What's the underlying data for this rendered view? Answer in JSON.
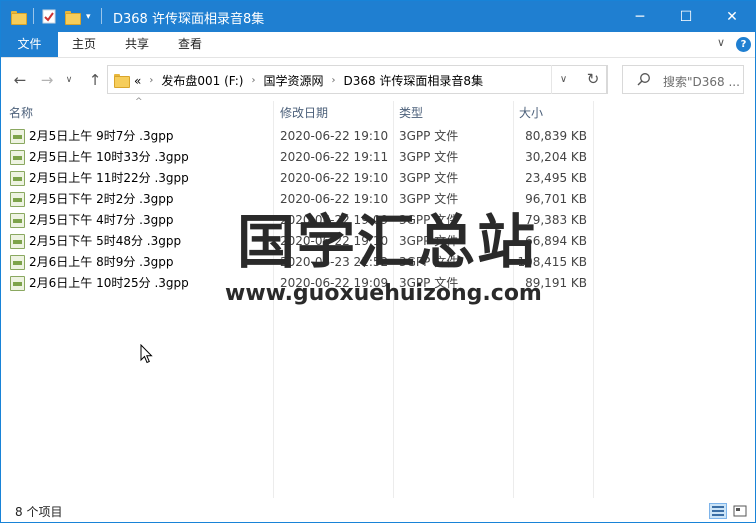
{
  "window": {
    "title": "D368 许传琛面相录音8集",
    "controls": {
      "minimize": "─",
      "maximize": "☐",
      "close": "✕"
    }
  },
  "ribbon": {
    "tabs": [
      "文件",
      "主页",
      "共享",
      "查看"
    ],
    "expand_glyph": "∨",
    "help_glyph": "?"
  },
  "nav": {
    "back": "←",
    "forward": "→",
    "recent": "∨",
    "up": "↑"
  },
  "address": {
    "overflow": "«",
    "crumbs": [
      "发布盘001 (F:)",
      "国学资源网",
      "D368 许传琛面相录音8集"
    ],
    "separator": "›",
    "dropdown": "∨",
    "refresh": "↻"
  },
  "search": {
    "placeholder": "搜索\"D368 ..."
  },
  "columns": {
    "name": "名称",
    "date": "修改日期",
    "type": "类型",
    "size": "大小"
  },
  "files": [
    {
      "name": "2月5日上午 9时7分 .3gpp",
      "date": "2020-06-22 19:10",
      "type": "3GPP 文件",
      "size": "80,839 KB"
    },
    {
      "name": "2月5日上午 10时33分 .3gpp",
      "date": "2020-06-22 19:11",
      "type": "3GPP 文件",
      "size": "30,204 KB"
    },
    {
      "name": "2月5日上午 11时22分 .3gpp",
      "date": "2020-06-22 19:10",
      "type": "3GPP 文件",
      "size": "23,495 KB"
    },
    {
      "name": "2月5日下午 2时2分 .3gpp",
      "date": "2020-06-22 19:10",
      "type": "3GPP 文件",
      "size": "96,701 KB"
    },
    {
      "name": "2月5日下午 4时7分 .3gpp",
      "date": "2020-06-22 19:09",
      "type": "3GPP 文件",
      "size": "79,383 KB"
    },
    {
      "name": "2月5日下午 5时48分 .3gpp",
      "date": "2020-06-22 19:10",
      "type": "3GPP 文件",
      "size": "66,894 KB"
    },
    {
      "name": "2月6日上午 8时9分 .3gpp",
      "date": "2020-06-23 21:52",
      "type": "3GPP 文件",
      "size": "108,415 KB"
    },
    {
      "name": "2月6日上午 10时25分 .3gpp",
      "date": "2020-06-22 19:09",
      "type": "3GPP 文件",
      "size": "89,191 KB"
    }
  ],
  "watermark": {
    "title": "国学汇总站",
    "url": "www.guoxuehuizong.com"
  },
  "status": {
    "item_count": "8 个项目"
  },
  "colors": {
    "accent": "#1f7fd1",
    "folder": "#f6cd5b",
    "header_text": "#4c607a"
  }
}
